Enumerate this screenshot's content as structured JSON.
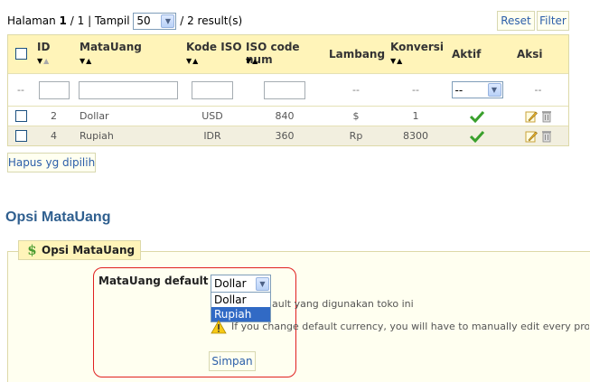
{
  "pager": {
    "halaman_label": "Halaman",
    "page": "1",
    "total_pages": "/ 1",
    "tampil_label": "| Tampil",
    "per_page": "50",
    "results": "/ 2 result(s)"
  },
  "buttons": {
    "reset": "Reset",
    "filter": "Filter",
    "delete_selected": "Hapus yg dipilih",
    "save": "Simpan"
  },
  "table": {
    "headers": {
      "id": "ID",
      "currency": "MataUang",
      "iso": "Kode ISO",
      "iso_num": "ISO code num",
      "symbol": "Lambang",
      "rate": "Konversi",
      "active": "Aktif",
      "actions": "Aksi"
    },
    "filter_placeholder_dash": "--",
    "active_filter_value": "--",
    "rows": [
      {
        "id": "2",
        "currency": "Dollar",
        "iso": "USD",
        "iso_num": "840",
        "symbol": "$",
        "rate": "1"
      },
      {
        "id": "4",
        "currency": "Rupiah",
        "iso": "IDR",
        "iso_num": "360",
        "symbol": "Rp",
        "rate": "8300"
      }
    ]
  },
  "section": {
    "title": "Opsi MataUang",
    "legend": "Opsi MataUang",
    "default_label": "MataUang default",
    "default_value": "Dollar",
    "options": [
      "Dollar",
      "Rupiah"
    ],
    "hint_partial": "ault yang digunakan toko ini",
    "warning": "If you change default currency, you will have to manually edit every product price."
  },
  "colors": {
    "header_bg": "#fff4b9",
    "check_green": "#3aa02c",
    "title_blue": "#2f5f8f",
    "highlight_red": "#e02020"
  }
}
